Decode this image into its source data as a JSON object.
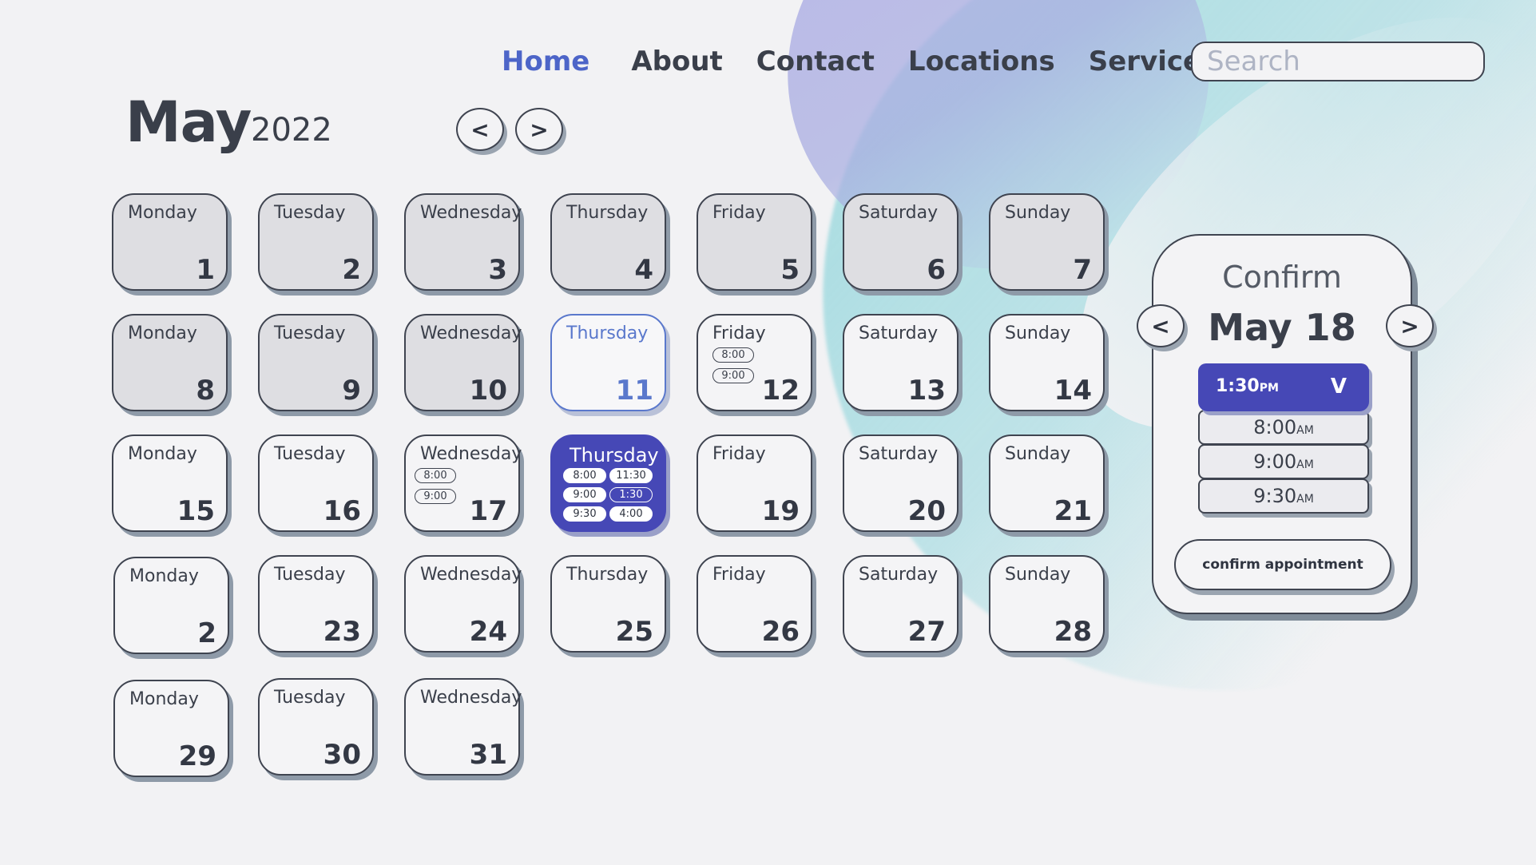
{
  "nav": {
    "home": "Home",
    "about": "About",
    "contact": "Contact",
    "locations": "Locations",
    "services": "Services",
    "search_placeholder": "Search"
  },
  "header": {
    "month": "May",
    "year": "2022",
    "prev": "<",
    "next": ">"
  },
  "days": [
    {
      "name": "Monday",
      "num": "1"
    },
    {
      "name": "Tuesday",
      "num": "2"
    },
    {
      "name": "Wednesday",
      "num": "3"
    },
    {
      "name": "Thursday",
      "num": "4"
    },
    {
      "name": "Friday",
      "num": "5"
    },
    {
      "name": "Saturday",
      "num": "6"
    },
    {
      "name": "Sunday",
      "num": "7"
    },
    {
      "name": "Monday",
      "num": "8"
    },
    {
      "name": "Tuesday",
      "num": "9"
    },
    {
      "name": "Wednesday",
      "num": "10"
    },
    {
      "name": "Thursday",
      "num": "11"
    },
    {
      "name": "Friday",
      "num": "12",
      "slots": [
        "8:00",
        "9:00"
      ]
    },
    {
      "name": "Saturday",
      "num": "13"
    },
    {
      "name": "Sunday",
      "num": "14"
    },
    {
      "name": "Monday",
      "num": "15"
    },
    {
      "name": "Tuesday",
      "num": "16"
    },
    {
      "name": "Wednesday",
      "num": "17",
      "slots": [
        "8:00",
        "9:00"
      ]
    },
    {
      "name": "Thursday",
      "slots": [
        "8:00",
        "11:30",
        "9:00",
        "1:30",
        "9:30",
        "4:00"
      ]
    },
    {
      "name": "Friday",
      "num": "19"
    },
    {
      "name": "Saturday",
      "num": "20"
    },
    {
      "name": "Sunday",
      "num": "21"
    },
    {
      "name": "Monday",
      "num": "2"
    },
    {
      "name": "Tuesday",
      "num": "23"
    },
    {
      "name": "Wednesday",
      "num": "24"
    },
    {
      "name": "Thursday",
      "num": "25"
    },
    {
      "name": "Friday",
      "num": "26"
    },
    {
      "name": "Saturday",
      "num": "27"
    },
    {
      "name": "Sunday",
      "num": "28"
    },
    {
      "name": "Monday",
      "num": "29"
    },
    {
      "name": "Tuesday",
      "num": "30"
    },
    {
      "name": "Wednesday",
      "num": "31"
    }
  ],
  "confirm": {
    "title": "Confirm",
    "date": "May 18",
    "prev": "<",
    "next": ">",
    "selected_time": "1:30",
    "selected_ampm": "PM",
    "options": [
      {
        "time": "8:00",
        "ampm": "AM"
      },
      {
        "time": "9:00",
        "ampm": "AM"
      },
      {
        "time": "9:30",
        "ampm": "AM"
      }
    ],
    "button": "confirm appointment"
  },
  "colors": {
    "accent": "#4648b6",
    "link_active": "#4d65c8",
    "today": "#5a78cc"
  }
}
